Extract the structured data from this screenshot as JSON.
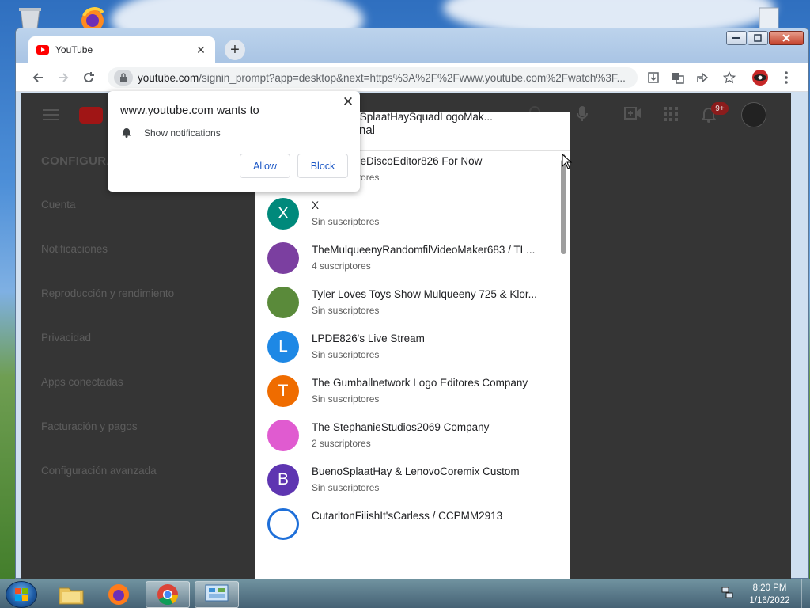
{
  "desktop": {
    "icons": [
      "recycle-bin-icon",
      "firefox-icon",
      "document-icon"
    ]
  },
  "window": {
    "tab_title": "YouTube",
    "url_host": "youtube.com",
    "url_path": "/signin_prompt?app=desktop&next=https%3A%2F%2Fwww.youtube.com%2Fwatch%3F..."
  },
  "youtube": {
    "notification_count": "9+",
    "settings": {
      "title": "CONFIGURA",
      "items": [
        "Cuenta",
        "Notificaciones",
        "Reproducción y rendimiento",
        "Privacidad",
        "Apps conectadas",
        "Facturación y pagos",
        "Configuración avanzada"
      ]
    }
  },
  "account_panel": {
    "title": "nal",
    "channels": [
      {
        "name": "ck} BuenoSplaatHaySquadLogoMak...",
        "subs": "tores",
        "initial": "",
        "color": "#9e9e9e"
      },
      {
        "name": "LogoPurpleDiscoEditor826 For Now",
        "subs": "Sin suscriptores",
        "initial": "L",
        "color": "#ef6c00"
      },
      {
        "name": "X",
        "subs": "Sin suscriptores",
        "initial": "X",
        "color": "#00897b"
      },
      {
        "name": "TheMulqueenyRandomfilVideoMaker683 / TL...",
        "subs": "4 suscriptores",
        "initial": "",
        "color": "#7b3fa0"
      },
      {
        "name": "Tyler Loves Toys Show Mulqueeny 725 & Klor...",
        "subs": "Sin suscriptores",
        "initial": "",
        "color": "#5a8a3a"
      },
      {
        "name": "LPDE826's Live Stream",
        "subs": "Sin suscriptores",
        "initial": "L",
        "color": "#1e88e5"
      },
      {
        "name": "The Gumballnetwork Logo Editores Company",
        "subs": "Sin suscriptores",
        "initial": "T",
        "color": "#ef6c00"
      },
      {
        "name": "The StephanieStudios2069 Company",
        "subs": "2 suscriptores",
        "initial": "",
        "color": "#e05bd0"
      },
      {
        "name": "BuenoSplaatHay & LenovoCoremix Custom",
        "subs": "Sin suscriptores",
        "initial": "B",
        "color": "#5e35b1"
      },
      {
        "name": "CutarltonFilishIt'sCarless / CCPMM2913",
        "subs": "",
        "initial": "",
        "color": "#1e6fd9"
      }
    ]
  },
  "permission_popup": {
    "title": "www.youtube.com wants to",
    "text": "Show notifications",
    "allow_label": "Allow",
    "block_label": "Block"
  },
  "taskbar": {
    "apps": [
      "file-explorer-icon",
      "firefox-icon",
      "chrome-icon",
      "control-panel-icon"
    ],
    "time": "8:20 PM",
    "date": "1/16/2022"
  }
}
